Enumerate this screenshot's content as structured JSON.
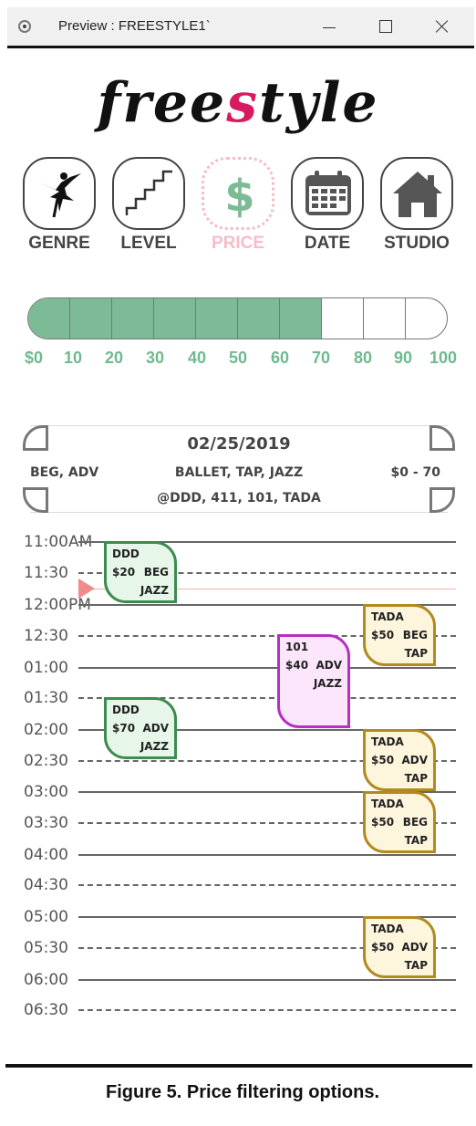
{
  "window": {
    "title": "Preview : FREESTYLE1`"
  },
  "logo": {
    "prefix": "free",
    "accent_letter": "s",
    "suffix": "tyle",
    "accent_color": "#d81b60"
  },
  "nav": [
    {
      "label": "GENRE",
      "icon": "ballerina-icon",
      "active": false
    },
    {
      "label": "LEVEL",
      "icon": "stairs-icon",
      "active": false
    },
    {
      "label": "PRICE",
      "icon": "dollar-icon",
      "active": true
    },
    {
      "label": "DATE",
      "icon": "calendar-icon",
      "active": false
    },
    {
      "label": "STUDIO",
      "icon": "house-icon",
      "active": false
    }
  ],
  "price_slider": {
    "ticks": [
      "$0",
      "10",
      "20",
      "30",
      "40",
      "50",
      "60",
      "70",
      "80",
      "90",
      "100"
    ],
    "selected_max": 70,
    "fill_color": "#7dbb96"
  },
  "summary": {
    "date": "02/25/2019",
    "levels": "BEG, ADV",
    "genres": "BALLET, TAP, JAZZ",
    "price_range": "$0 - 70",
    "studios": "@DDD, 411, 101, TADA"
  },
  "schedule": {
    "times": [
      "11:00AM",
      "11:30",
      "12:00PM",
      "12:30",
      "01:00",
      "01:30",
      "02:00",
      "02:30",
      "03:00",
      "03:30",
      "04:00",
      "04:30",
      "05:00",
      "05:30",
      "06:00",
      "06:30"
    ],
    "events": [
      {
        "studio": "DDD",
        "price": "$20",
        "level": "BEG",
        "genre": "JAZZ",
        "color": "green"
      },
      {
        "studio": "TADA",
        "price": "$50",
        "level": "BEG",
        "genre": "TAP",
        "color": "gold"
      },
      {
        "studio": "101",
        "price": "$40",
        "level": "ADV",
        "genre": "JAZZ",
        "color": "purple"
      },
      {
        "studio": "DDD",
        "price": "$70",
        "level": "ADV",
        "genre": "JAZZ",
        "color": "green"
      },
      {
        "studio": "TADA",
        "price": "$50",
        "level": "ADV",
        "genre": "TAP",
        "color": "gold"
      },
      {
        "studio": "TADA",
        "price": "$50",
        "level": "BEG",
        "genre": "TAP",
        "color": "gold"
      },
      {
        "studio": "TADA",
        "price": "$50",
        "level": "ADV",
        "genre": "TAP",
        "color": "gold"
      }
    ]
  },
  "caption": "Figure 5. Price filtering options."
}
